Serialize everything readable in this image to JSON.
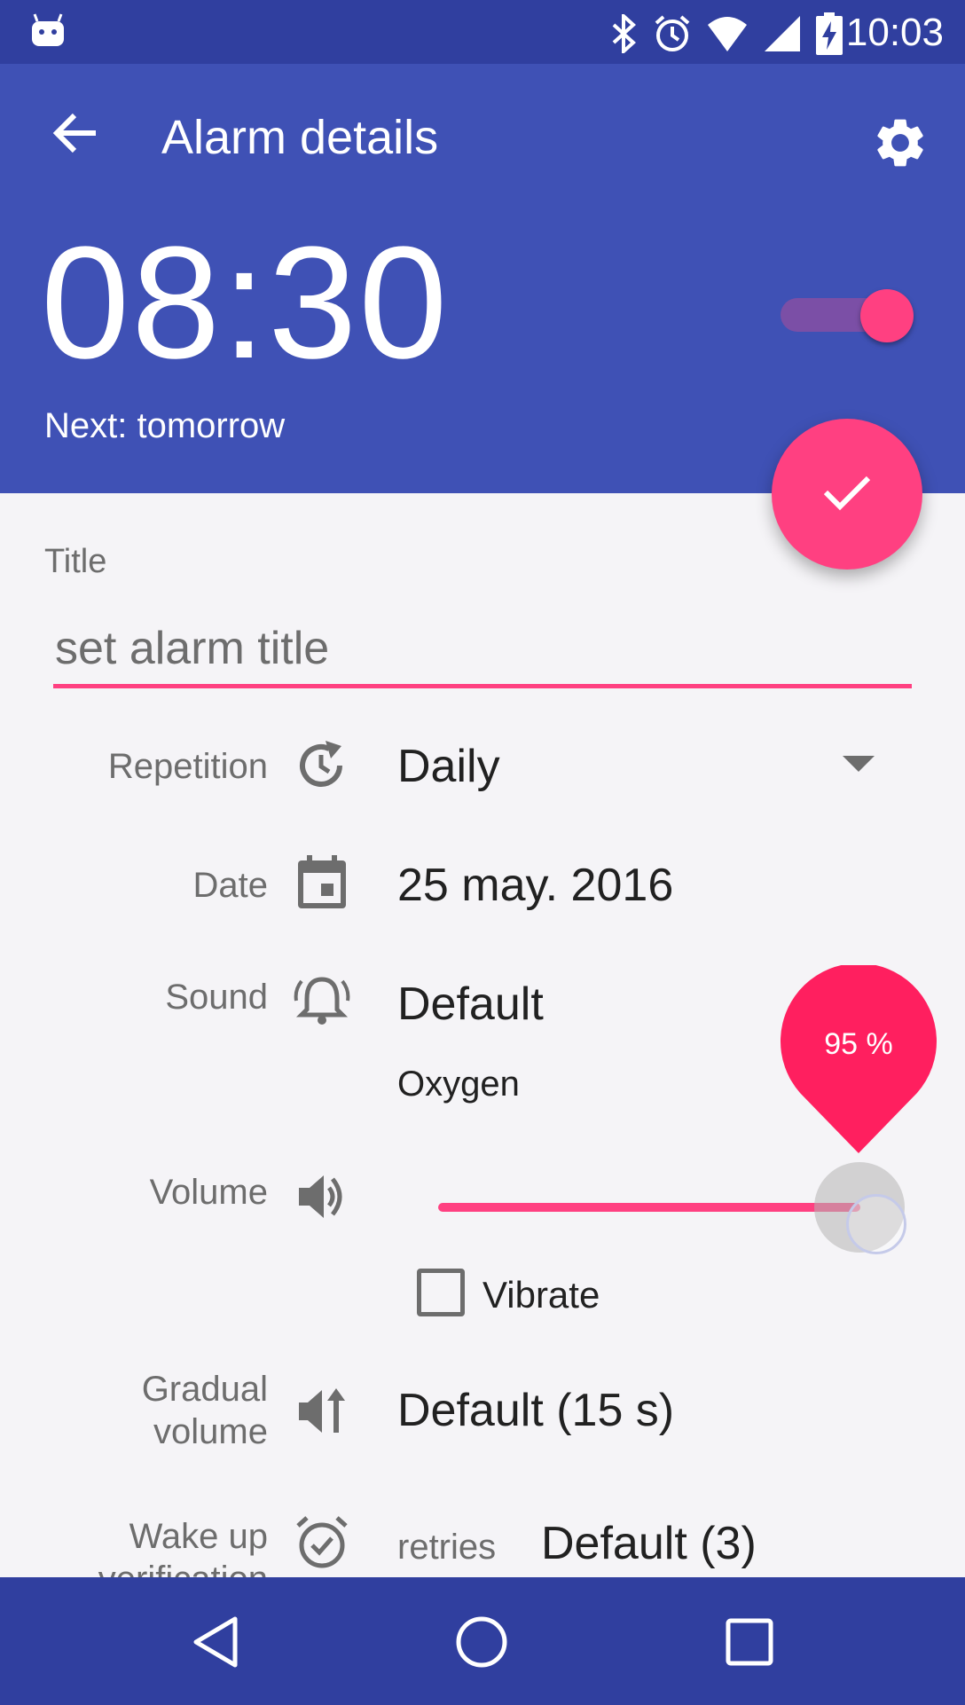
{
  "status_bar": {
    "time": "10:03",
    "icons": [
      "android-icon",
      "bluetooth-icon",
      "alarm-icon",
      "wifi-icon",
      "signal-icon",
      "battery-charging-icon"
    ]
  },
  "header": {
    "title": "Alarm details",
    "alarm_time": "08:30",
    "next": "Next: tomorrow",
    "alarm_enabled": true,
    "back_icon": "arrow-back-icon",
    "settings_icon": "gear-icon",
    "fab_icon": "check-icon"
  },
  "form": {
    "title_label": "Title",
    "title_placeholder": "set alarm title",
    "repetition": {
      "label": "Repetition",
      "value": "Daily",
      "icon": "history-icon"
    },
    "date": {
      "label": "Date",
      "value": "25 may. 2016",
      "icon": "calendar-icon"
    },
    "sound": {
      "label": "Sound",
      "value": "Default",
      "sub": "Oxygen",
      "icon": "bell-icon"
    },
    "volume": {
      "label": "Volume",
      "percent_label": "95 %",
      "level": 0.95,
      "icon": "volume-up-icon"
    },
    "vibrate": {
      "label": "Vibrate",
      "checked": false
    },
    "gradual_volume": {
      "label_line1": "Gradual",
      "label_line2": "volume",
      "value": "Default (15 s)",
      "icon": "volume-increase-icon"
    },
    "wake_up": {
      "label_line1": "Wake up",
      "label_line2": "verification",
      "retries_label": "retries",
      "retries_value": "Default (3)",
      "icon": "alarm-check-icon"
    }
  },
  "colors": {
    "primary": "#3f51b5",
    "primary_dark": "#303f9f",
    "accent": "#ff4081"
  },
  "nav": {
    "back": "nav-back-icon",
    "home": "nav-home-icon",
    "recents": "nav-recents-icon"
  }
}
